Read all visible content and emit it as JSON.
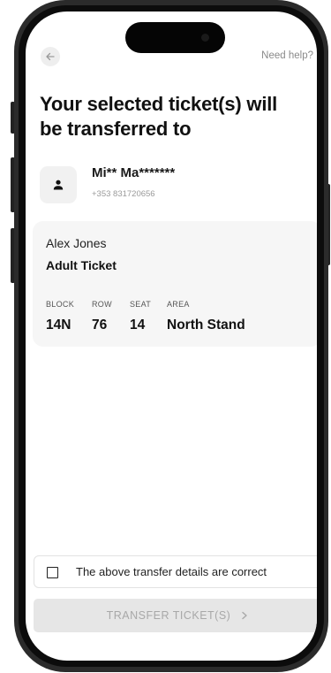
{
  "header": {
    "help_label": "Need help?"
  },
  "title": "Your selected ticket(s) will be transferred to",
  "recipient": {
    "name": "Mi** Ma*******",
    "phone": "+353 831720656"
  },
  "ticket": {
    "holder_name": "Alex Jones",
    "type": "Adult Ticket",
    "fields": [
      {
        "label": "BLOCK",
        "value": "14N"
      },
      {
        "label": "ROW",
        "value": "76"
      },
      {
        "label": "SEAT",
        "value": "14"
      },
      {
        "label": "AREA",
        "value": "North Stand"
      }
    ]
  },
  "confirmation": {
    "label": "The above transfer details are correct",
    "checked": false
  },
  "transfer_button": {
    "label": "TRANSFER TICKET(S)",
    "enabled": false
  },
  "icons": {
    "back": "arrow-left-icon",
    "avatar": "user-icon",
    "chevron": "chevron-right-icon"
  },
  "colors": {
    "card_background": "#f6f6f6",
    "button_disabled": "#e6e6e6",
    "button_disabled_text": "#a8a8a8",
    "muted_text": "#8a8a8a"
  }
}
